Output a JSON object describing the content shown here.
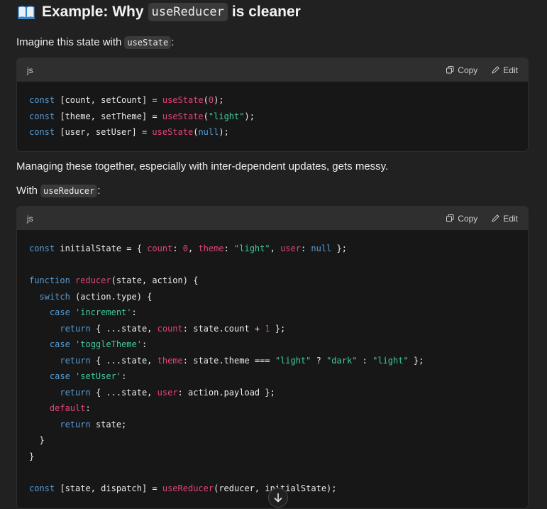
{
  "heading": {
    "prefix": "Example: Why",
    "code": "useReducer",
    "suffix": "is cleaner",
    "icon": "open-book-icon"
  },
  "para1": {
    "text": "Imagine this state with",
    "code": "useState",
    "after": ":"
  },
  "block1": {
    "lang": "js",
    "copy_label": "Copy",
    "edit_label": "Edit",
    "lines": [
      [
        [
          "k",
          "const "
        ],
        [
          "t",
          "[count, setCount] = "
        ],
        [
          "f",
          "useState"
        ],
        [
          "t",
          "("
        ],
        [
          "n",
          "0"
        ],
        [
          "t",
          ");"
        ]
      ],
      [
        [
          "k",
          "const "
        ],
        [
          "t",
          "[theme, setTheme] = "
        ],
        [
          "f",
          "useState"
        ],
        [
          "t",
          "("
        ],
        [
          "s",
          "\"light\""
        ],
        [
          "t",
          ");"
        ]
      ],
      [
        [
          "k",
          "const "
        ],
        [
          "t",
          "[user, setUser] = "
        ],
        [
          "f",
          "useState"
        ],
        [
          "t",
          "("
        ],
        [
          "k",
          "null"
        ],
        [
          "t",
          ");"
        ]
      ]
    ]
  },
  "para2": {
    "text": "Managing these together, especially with inter-dependent updates, gets messy."
  },
  "para3": {
    "text": "With",
    "code": "useReducer",
    "after": ":"
  },
  "block2": {
    "lang": "js",
    "copy_label": "Copy",
    "edit_label": "Edit",
    "lines": [
      [
        [
          "k",
          "const "
        ],
        [
          "t",
          "initialState = { "
        ],
        [
          "p",
          "count"
        ],
        [
          "t",
          ": "
        ],
        [
          "n",
          "0"
        ],
        [
          "t",
          ", "
        ],
        [
          "p",
          "theme"
        ],
        [
          "t",
          ": "
        ],
        [
          "s",
          "\"light\""
        ],
        [
          "t",
          ", "
        ],
        [
          "p",
          "user"
        ],
        [
          "t",
          ": "
        ],
        [
          "k",
          "null"
        ],
        [
          "t",
          " };"
        ]
      ],
      [],
      [
        [
          "k",
          "function "
        ],
        [
          "f",
          "reducer"
        ],
        [
          "t",
          "(state, action) {"
        ]
      ],
      [
        [
          "t",
          "  "
        ],
        [
          "k",
          "switch "
        ],
        [
          "t",
          "(action.type) {"
        ]
      ],
      [
        [
          "t",
          "    "
        ],
        [
          "k",
          "case "
        ],
        [
          "s",
          "'increment'"
        ],
        [
          "t",
          ":"
        ]
      ],
      [
        [
          "t",
          "      "
        ],
        [
          "k",
          "return "
        ],
        [
          "t",
          "{ ...state, "
        ],
        [
          "p",
          "count"
        ],
        [
          "t",
          ": state.count + "
        ],
        [
          "n",
          "1"
        ],
        [
          "t",
          " };"
        ]
      ],
      [
        [
          "t",
          "    "
        ],
        [
          "k",
          "case "
        ],
        [
          "s",
          "'toggleTheme'"
        ],
        [
          "t",
          ":"
        ]
      ],
      [
        [
          "t",
          "      "
        ],
        [
          "k",
          "return "
        ],
        [
          "t",
          "{ ...state, "
        ],
        [
          "p",
          "theme"
        ],
        [
          "t",
          ": state.theme === "
        ],
        [
          "s",
          "\"light\""
        ],
        [
          "t",
          " ? "
        ],
        [
          "s",
          "\"dark\""
        ],
        [
          "t",
          " : "
        ],
        [
          "s",
          "\"light\""
        ],
        [
          "t",
          " };"
        ]
      ],
      [
        [
          "t",
          "    "
        ],
        [
          "k",
          "case "
        ],
        [
          "s",
          "'setUser'"
        ],
        [
          "t",
          ":"
        ]
      ],
      [
        [
          "t",
          "      "
        ],
        [
          "k",
          "return "
        ],
        [
          "t",
          "{ ...state, "
        ],
        [
          "p",
          "user"
        ],
        [
          "t",
          ": action.payload };"
        ]
      ],
      [
        [
          "t",
          "    "
        ],
        [
          "p",
          "default"
        ],
        [
          "t",
          ":"
        ]
      ],
      [
        [
          "t",
          "      "
        ],
        [
          "k",
          "return "
        ],
        [
          "t",
          "state;"
        ]
      ],
      [
        [
          "t",
          "  }"
        ]
      ],
      [
        [
          "t",
          "}"
        ]
      ],
      [],
      [
        [
          "k",
          "const "
        ],
        [
          "t",
          "[state, dispatch] = "
        ],
        [
          "f",
          "useReducer"
        ],
        [
          "t",
          "(reducer, initialState);"
        ]
      ]
    ]
  },
  "scroll_button": {
    "icon": "arrow-down-icon"
  },
  "colors": {
    "keyword": "#569cd6",
    "function": "#e0467a",
    "string": "#40c9a2",
    "number": "#e0467a",
    "background": "#212121",
    "code_bg": "#171717",
    "header_bg": "#2f2f2f"
  }
}
